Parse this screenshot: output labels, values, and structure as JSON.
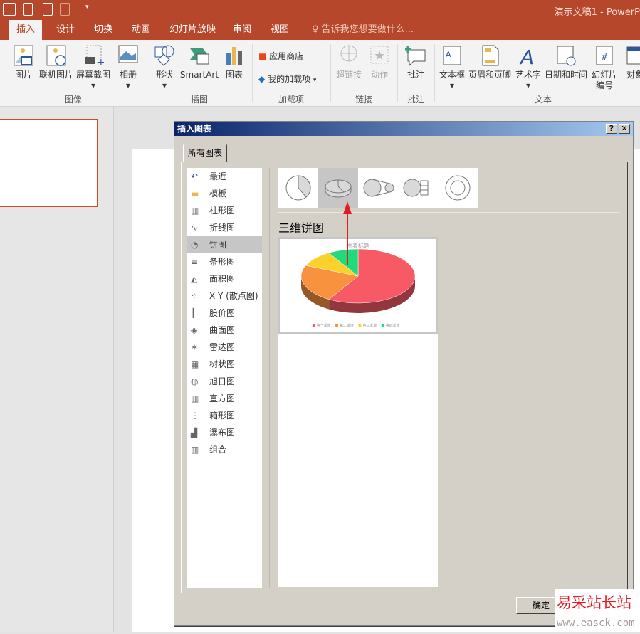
{
  "window": {
    "title": "演示文稿1 - PowerP"
  },
  "tabs": [
    {
      "label": "插入",
      "active": true
    },
    {
      "label": "设计"
    },
    {
      "label": "切换"
    },
    {
      "label": "动画"
    },
    {
      "label": "幻灯片放映"
    },
    {
      "label": "审阅"
    },
    {
      "label": "视图"
    }
  ],
  "tell_me": "告诉我您想要做什么...",
  "ribbon": {
    "buttons": {
      "picture": "图片",
      "online_picture": "联机图片",
      "screenshot": "屏幕截图",
      "album": "相册",
      "shapes": "形状",
      "smartart": "SmartArt",
      "chart": "图表",
      "store": "应用商店",
      "my_addins": "我的加载项",
      "hyperlink": "超链接",
      "action": "动作",
      "comment": "批注",
      "textbox": "文本框",
      "header_footer": "页眉和页脚",
      "wordart": "艺术字",
      "datetime": "日期和时间",
      "slide_number_1": "幻灯片",
      "slide_number_2": "编号",
      "object": "对象"
    },
    "groups": {
      "images": "图像",
      "illustrations": "插图",
      "addins": "加载项",
      "links": "链接",
      "comments": "批注",
      "text": "文本"
    }
  },
  "dialog": {
    "title": "插入图表",
    "help": "?",
    "close": "✕",
    "tab": "所有图表",
    "types": [
      "最近",
      "模板",
      "柱形图",
      "折线图",
      "饼图",
      "条形图",
      "面积图",
      "X Y (散点图)",
      "股价图",
      "曲面图",
      "雷达图",
      "树状图",
      "旭日图",
      "直方图",
      "箱形图",
      "瀑布图",
      "组合"
    ],
    "selected_type": "饼图",
    "subtypes": [
      "饼图",
      "三维饼图",
      "子母饼图",
      "复合条饼图",
      "圆环图"
    ],
    "selected_subtype": "三维饼图",
    "heading": "三维饼图",
    "preview": {
      "title": "图表标题",
      "legend": [
        "第一季度",
        "第二季度",
        "第三季度",
        "第四季度"
      ]
    },
    "ok": "确定"
  },
  "chart_data": {
    "type": "pie",
    "categories": [
      "第一季度",
      "第二季度",
      "第三季度",
      "第四季度"
    ],
    "values": [
      58.6,
      22.9,
      10,
      8.6
    ],
    "colors": [
      "#f75a65",
      "#f9923f",
      "#fbd12c",
      "#22d97c"
    ]
  },
  "colors": {
    "accent": "#b7472a",
    "dialog_bg": "#d4d0c8"
  },
  "watermark": {
    "text": "易采站长站",
    "url": "www.easck.com"
  }
}
